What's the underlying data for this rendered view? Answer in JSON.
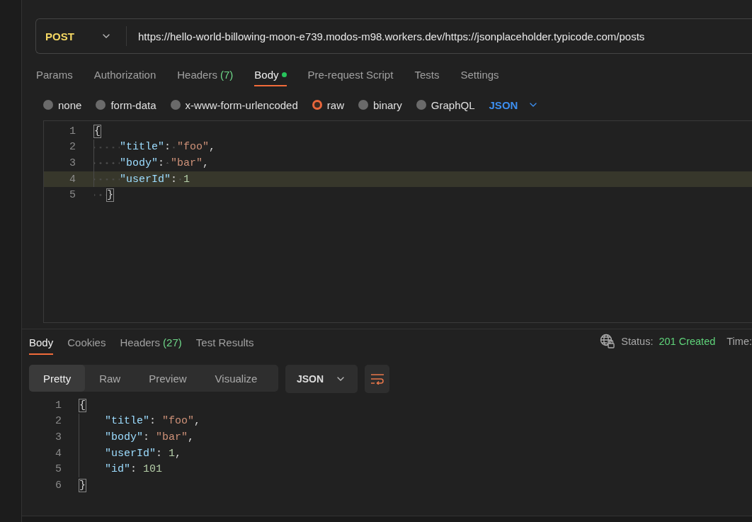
{
  "request": {
    "method": "POST",
    "url": "https://hello-world-billowing-moon-e739.modos-m98.workers.dev/https://jsonplaceholder.typicode.com/posts"
  },
  "request_tabs": [
    {
      "label": "Params",
      "selected": false
    },
    {
      "label": "Authorization",
      "selected": false
    },
    {
      "label": "Headers",
      "count": "(7)",
      "selected": false
    },
    {
      "label": "Body",
      "has_content": true,
      "selected": true
    },
    {
      "label": "Pre-request Script",
      "selected": false
    },
    {
      "label": "Tests",
      "selected": false
    },
    {
      "label": "Settings",
      "selected": false
    }
  ],
  "body_types": [
    {
      "label": "none",
      "selected": false
    },
    {
      "label": "form-data",
      "selected": false
    },
    {
      "label": "x-www-form-urlencoded",
      "selected": false
    },
    {
      "label": "raw",
      "selected": true
    },
    {
      "label": "binary",
      "selected": false
    },
    {
      "label": "GraphQL",
      "selected": false
    }
  ],
  "body_format": "JSON",
  "request_editor": {
    "show_whitespace": true,
    "lines": [
      {
        "number": "1",
        "current": false,
        "tokens": [
          {
            "kind": "brace",
            "text": "{"
          }
        ]
      },
      {
        "number": "2",
        "current": false,
        "tokens": [
          {
            "kind": "indent"
          },
          {
            "kind": "key",
            "text": "\"title\""
          },
          {
            "kind": "punct",
            "text": ":"
          },
          {
            "kind": "gap"
          },
          {
            "kind": "string",
            "text": "\"foo\""
          },
          {
            "kind": "punct",
            "text": ","
          }
        ]
      },
      {
        "number": "3",
        "current": false,
        "tokens": [
          {
            "kind": "indent"
          },
          {
            "kind": "key",
            "text": "\"body\""
          },
          {
            "kind": "punct",
            "text": ":"
          },
          {
            "kind": "gap"
          },
          {
            "kind": "string",
            "text": "\"bar\""
          },
          {
            "kind": "punct",
            "text": ","
          }
        ]
      },
      {
        "number": "4",
        "current": true,
        "tokens": [
          {
            "kind": "indent"
          },
          {
            "kind": "key",
            "text": "\"userId\""
          },
          {
            "kind": "punct",
            "text": ":"
          },
          {
            "kind": "gap"
          },
          {
            "kind": "number",
            "text": "1"
          }
        ]
      },
      {
        "number": "5",
        "current": false,
        "tokens": [
          {
            "kind": "pad"
          },
          {
            "kind": "brace",
            "text": "}"
          }
        ]
      }
    ]
  },
  "response_tabs": [
    {
      "label": "Body",
      "selected": true
    },
    {
      "label": "Cookies",
      "selected": false
    },
    {
      "label": "Headers",
      "count": "(27)",
      "selected": false
    },
    {
      "label": "Test Results",
      "selected": false
    }
  ],
  "status": {
    "label": "Status:",
    "value": "201 Created",
    "time_label": "Time:"
  },
  "view_modes": [
    {
      "label": "Pretty",
      "selected": true
    },
    {
      "label": "Raw",
      "selected": false
    },
    {
      "label": "Preview",
      "selected": false
    },
    {
      "label": "Visualize",
      "selected": false
    }
  ],
  "response_format": "JSON",
  "response_editor": {
    "show_whitespace": false,
    "lines": [
      {
        "number": "1",
        "tokens": [
          {
            "kind": "brace",
            "text": "{"
          }
        ]
      },
      {
        "number": "2",
        "tokens": [
          {
            "kind": "indent"
          },
          {
            "kind": "key",
            "text": "\"title\""
          },
          {
            "kind": "punct",
            "text": ":"
          },
          {
            "kind": "gap"
          },
          {
            "kind": "string",
            "text": "\"foo\""
          },
          {
            "kind": "punct",
            "text": ","
          }
        ]
      },
      {
        "number": "3",
        "tokens": [
          {
            "kind": "indent"
          },
          {
            "kind": "key",
            "text": "\"body\""
          },
          {
            "kind": "punct",
            "text": ":"
          },
          {
            "kind": "gap"
          },
          {
            "kind": "string",
            "text": "\"bar\""
          },
          {
            "kind": "punct",
            "text": ","
          }
        ]
      },
      {
        "number": "4",
        "tokens": [
          {
            "kind": "indent"
          },
          {
            "kind": "key",
            "text": "\"userId\""
          },
          {
            "kind": "punct",
            "text": ":"
          },
          {
            "kind": "gap"
          },
          {
            "kind": "number",
            "text": "1"
          },
          {
            "kind": "punct",
            "text": ","
          }
        ]
      },
      {
        "number": "5",
        "tokens": [
          {
            "kind": "indent"
          },
          {
            "kind": "key",
            "text": "\"id\""
          },
          {
            "kind": "punct",
            "text": ":"
          },
          {
            "kind": "gap"
          },
          {
            "kind": "number",
            "text": "101"
          }
        ]
      },
      {
        "number": "6",
        "tokens": [
          {
            "kind": "brace",
            "text": "}"
          }
        ]
      }
    ]
  }
}
